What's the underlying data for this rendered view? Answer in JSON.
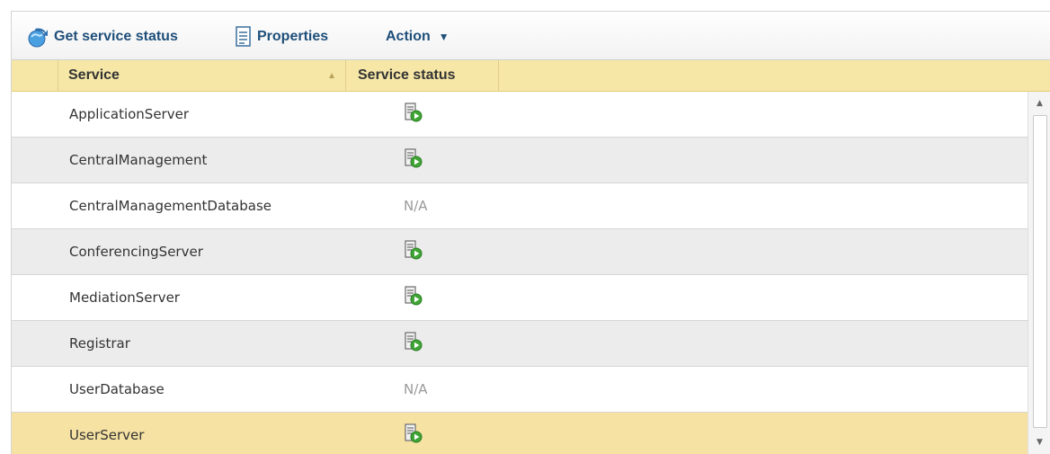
{
  "toolbar": {
    "get_status_label": "Get service status",
    "properties_label": "Properties",
    "action_label": "Action",
    "action_caret": "▼"
  },
  "grid": {
    "columns": {
      "service": "Service",
      "service_sort_indicator": "▲",
      "status": "Service status"
    },
    "rows": [
      {
        "service": "ApplicationServer",
        "status": "running-icon",
        "selected": false
      },
      {
        "service": "CentralManagement",
        "status": "running-icon",
        "selected": false
      },
      {
        "service": "CentralManagementDatabase",
        "status": "N/A",
        "selected": false
      },
      {
        "service": "ConferencingServer",
        "status": "running-icon",
        "selected": false
      },
      {
        "service": "MediationServer",
        "status": "running-icon",
        "selected": false
      },
      {
        "service": "Registrar",
        "status": "running-icon",
        "selected": false
      },
      {
        "service": "UserDatabase",
        "status": "N/A",
        "selected": false
      },
      {
        "service": "UserServer",
        "status": "running-icon",
        "selected": true
      }
    ]
  },
  "colors": {
    "toolbar_text": "#1f4f7a",
    "header_bg": "#f6e7a7",
    "row_alt_bg": "#ececec",
    "selected_bg": "#f6e2a3"
  }
}
